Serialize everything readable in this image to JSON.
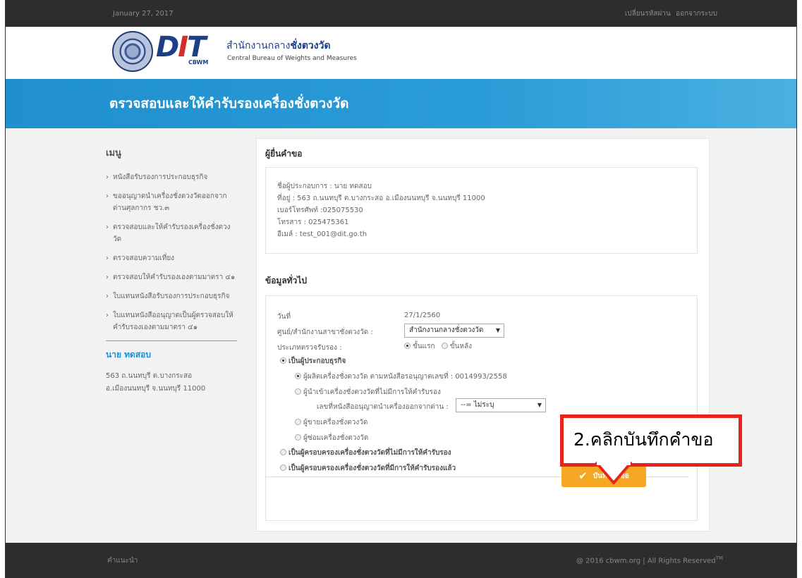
{
  "topbar": {
    "date": "January 27, 2017",
    "change_password": "เปลี่ยนรหัสผ่าน",
    "logout": "ออกจากระบบ"
  },
  "brand": {
    "logo_text": "DIT",
    "logo_sub": "CBWM",
    "org_name_th_prefix": "สำนักงานกลาง",
    "org_name_th_bold": "ชั่งตวงวัด",
    "org_name_en": "Central Bureau of Weights and Measures"
  },
  "banner": {
    "title": "ตรวจสอบและให้คำรับรองเครื่องชั่งตวงวัด"
  },
  "sidebar": {
    "menu_title": "เมนู",
    "items": [
      {
        "label": "หนังสือรับรองการประกอบธุรกิจ"
      },
      {
        "label": "ขออนุญาตนำเครื่องชั่งตวงวัดออกจากด่านศุลกากร ชว.๓"
      },
      {
        "label": "ตรวจสอบและให้คำรับรองเครื่องชั่งตวงวัด"
      },
      {
        "label": "ตรวจสอบความเที่ยง"
      },
      {
        "label": "ตรวจสอบให้คำรับรองเองตามมาตรา ๔๑"
      },
      {
        "label": "ใบแทนหนังสือรับรองการประกอบธุรกิจ"
      },
      {
        "label": "ใบแทนหนังสืออนุญาตเป็นผู้ตรวจสอบให้คำรับรองเองตามมาตรา ๔๑"
      }
    ],
    "user_name": "นาย ทดสอบ",
    "address_line1": "563 ถ.นนทบุรี ต.บางกระสอ",
    "address_line2": "อ.เมืองนนทบุรี จ.นนทบุรี 11000"
  },
  "applicant": {
    "section_title": "ผู้ยื่นคำขอ",
    "operator": "ชื่อผู้ประกอบการ : นาย ทดสอบ",
    "address": "ที่อยู่ : 563 ถ.นนทบุรี ต.บางกระสอ อ.เมืองนนทบุรี จ.นนทบุรี 11000",
    "phone": "เบอร์โทรศัพท์ :025075530",
    "fax": "โทรสาร : 025475361",
    "email": "อีเมล์ : test_001@dit.go.th"
  },
  "general": {
    "section_title": "ข้อมูลทั่วไป",
    "date_label": "วันที่",
    "date_value": "27/1/2560",
    "center_label": "ศูนย์/สำนักงานสาขาชั่งตวงวัด :",
    "center_value": "สำนักงานกลางชั่งตวงวัด",
    "cert_type_label": "ประเภทตรวจรับรอง :",
    "cert_type_first": "ขั้นแรก",
    "cert_type_later": "ขั้นหลัง",
    "business_operator": "เป็นผู้ประกอบธุรกิจ",
    "manufacturer": "ผู้ผลิตเครื่องชั่งตวงวัด ตามหนังสือรอนุญาตเลขที่ : 0014993/2558",
    "importer": "ผู้นำเข้าเครื่องชั่งตวงวัดที่ไม่มีการให้คำรับรอง",
    "import_permit_label": "เลขที่หนังสืออนุญาตนำเครื่องออกจากด่าน :",
    "import_permit_value": "--= ไม่ระบุ",
    "seller": "ผู้ขายเครื่องชั่งตวงวัด",
    "repairer": "ผู้ซ่อมเครื่องชั่งตวงวัด",
    "possessor_uncertified": "เป็นผู้ครอบครองเครื่องชั่งตวงวัดที่ไม่มีการให้คำรับรอง",
    "possessor_certified": "เป็นผู้ครอบครองเครื่องชั่งตวงวัดที่มีการให้คำรับรองแล้ว"
  },
  "actions": {
    "save_label": "บันทึกคำขอ"
  },
  "annotation": {
    "text": "2.คลิกบันทึกคำขอ",
    "color": "#e8231b"
  },
  "footer": {
    "left": "คำแนะนำ",
    "right": "@ 2016 cbwm.org | All Rights Reserved",
    "tm": "TM"
  },
  "colors": {
    "accent": "#1f8fce",
    "button": "#f5a623",
    "dark": "#2d2d2d"
  }
}
